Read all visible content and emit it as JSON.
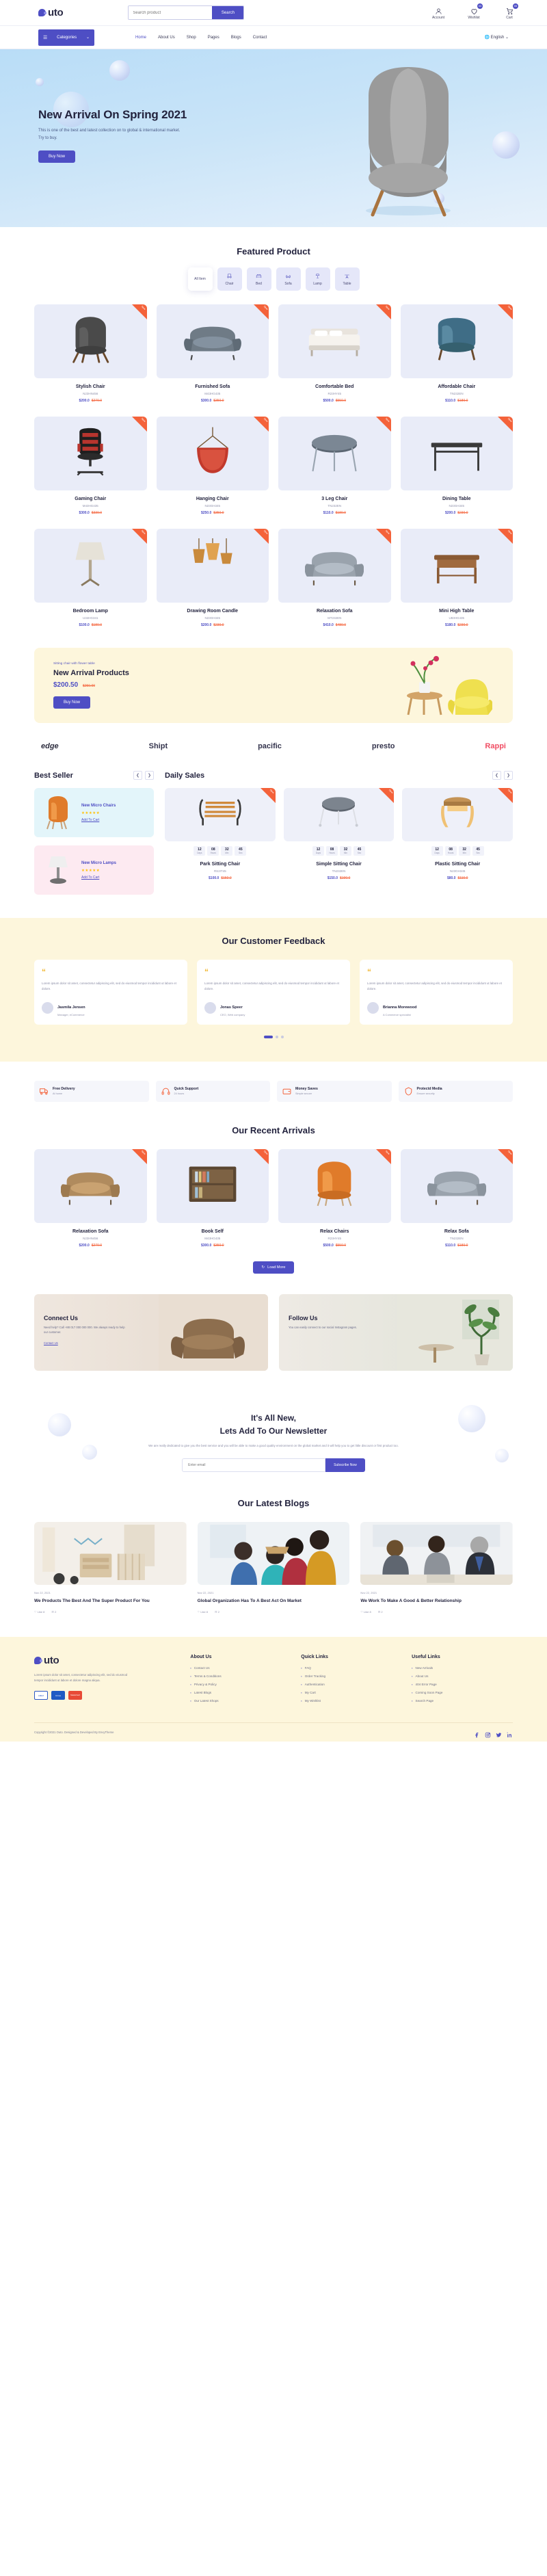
{
  "brand": {
    "name": "uto"
  },
  "header": {
    "search": {
      "placeholder": "Search product",
      "value": "",
      "button": "Search"
    },
    "icons": [
      {
        "name": "Account",
        "badge": ""
      },
      {
        "name": "Wishlist",
        "badge": "03"
      },
      {
        "name": "Cart",
        "badge": "05"
      }
    ]
  },
  "nav": {
    "categories_label": "Categories",
    "links": [
      {
        "label": "Home",
        "caret": true,
        "active": true
      },
      {
        "label": "About Us",
        "caret": false,
        "active": false
      },
      {
        "label": "Shop",
        "caret": true,
        "active": false
      },
      {
        "label": "Pages",
        "caret": true,
        "active": false
      },
      {
        "label": "Blogs",
        "caret": true,
        "active": false
      },
      {
        "label": "Contact",
        "caret": false,
        "active": false
      }
    ],
    "language": "English"
  },
  "hero": {
    "title": "New Arrival On Spring 2021",
    "text": "This is one of the best and latest collection on to global & international market. Try to buy.",
    "cta": "Buy Now"
  },
  "featured": {
    "title": "Featured Product",
    "tabs": [
      {
        "label": "All Item",
        "icon": "grid-icon",
        "active": true
      },
      {
        "label": "Chair",
        "icon": "chair-icon",
        "active": false
      },
      {
        "label": "Bed",
        "icon": "bed-icon",
        "active": false
      },
      {
        "label": "Sofa",
        "icon": "sofa-icon",
        "active": false
      },
      {
        "label": "Lamp",
        "icon": "lamp-icon",
        "active": false
      },
      {
        "label": "Table",
        "icon": "table-icon",
        "active": false
      }
    ],
    "ribbon": "New",
    "products": [
      {
        "name": "Stylish Chair",
        "sku": "N23HN456",
        "price": "$200.0",
        "old": "$270.0",
        "art": "chair-dark"
      },
      {
        "name": "Furnished Sofa",
        "sku": "M43HG435",
        "price": "$300.0",
        "old": "$350.0",
        "art": "sofa-grey"
      },
      {
        "name": "Comfortable Bed",
        "sku": "R23HY45",
        "price": "$500.0",
        "old": "$550.0",
        "art": "bed-white"
      },
      {
        "name": "Affordable Chair",
        "sku": "TN232EN",
        "price": "$110.0",
        "old": "$180.0",
        "art": "chair-blue"
      },
      {
        "name": "Gaming Chair",
        "sku": "M43HG435",
        "price": "$300.0",
        "old": "$330.0",
        "art": "chair-gaming"
      },
      {
        "name": "Hanging Chair",
        "sku": "N23GH345",
        "price": "$250.0",
        "old": "$350.0",
        "art": "chair-hanging"
      },
      {
        "name": "3 Leg Chair",
        "sku": "TN232EN",
        "price": "$110.0",
        "old": "$180.0",
        "art": "table-round"
      },
      {
        "name": "Dining Table",
        "sku": "N23GH345",
        "price": "$200.0",
        "old": "$230.0",
        "art": "table-dining"
      },
      {
        "name": "Bedroom Lamp",
        "sku": "U34HG341",
        "price": "$100.0",
        "old": "$180.0",
        "art": "lamp-floor"
      },
      {
        "name": "Drawing Room Candle",
        "sku": "N23GH345",
        "price": "$200.0",
        "old": "$230.0",
        "art": "lamp-pendant"
      },
      {
        "name": "Relaxation Sofa",
        "sku": "MT232EN",
        "price": "$410.0",
        "old": "$480.0",
        "art": "sofa-relax"
      },
      {
        "name": "Mini High Table",
        "sku": "U83HG435",
        "price": "$180.0",
        "old": "$230.0",
        "art": "table-mini"
      }
    ]
  },
  "promo": {
    "eyebrow": "Sitting chair with flower table",
    "title": "New Arrival Products",
    "price": "$200.50",
    "old": "$250.00",
    "cta": "Buy Now"
  },
  "brands": [
    "edge",
    "Shipt",
    "pacific",
    "presto",
    "Rappi"
  ],
  "best_seller": {
    "title": "Best Seller",
    "items": [
      {
        "name": "New Micro Chairs",
        "stars": "★★★★★",
        "cta": "Add To Cart",
        "theme": "blue",
        "art": "chair-orange"
      },
      {
        "name": "New Micro Lamps",
        "stars": "★★★★★",
        "cta": "Add To Cart",
        "theme": "pink",
        "art": "lamp-small"
      }
    ]
  },
  "daily_sales": {
    "title": "Daily Sales",
    "timer_labels": [
      "Days",
      "Hours",
      "Min",
      "Sec"
    ],
    "items": [
      {
        "name": "Park Sitting Chair",
        "sku": "RS2IT45",
        "price": "$100.0",
        "old": "$150.0",
        "timer": [
          "12",
          "08",
          "32",
          "45"
        ],
        "art": "bench"
      },
      {
        "name": "Simple Sitting Chair",
        "sku": "TN232EN",
        "price": "$150.0",
        "old": "$190.0",
        "timer": [
          "12",
          "08",
          "32",
          "45"
        ],
        "art": "stool-grey"
      },
      {
        "name": "Plastic Sitting Chair",
        "sku": "N23GH345",
        "price": "$80.0",
        "old": "$110.0",
        "timer": [
          "12",
          "08",
          "32",
          "45"
        ],
        "art": "stool-wood"
      }
    ]
  },
  "feedback": {
    "title": "Our Customer Feedback",
    "cards": [
      {
        "text": "Lorem ipsum dolor sit amet, consectetur adipiscing elit, sed do eiusmod tempor incididunt ut labore et dolore.",
        "name": "Jasmila Jensen",
        "role": "Manager, eCommerce"
      },
      {
        "text": "Lorem ipsum dolor sit amet, consectetur adipiscing elit, sed do eiusmod tempor incididunt ut labore et dolore.",
        "name": "Jonas Speer",
        "role": "CEO, Web company"
      },
      {
        "text": "Lorem ipsum dolor sit amet, consectetur adipiscing elit, sed do eiusmod tempor incididunt ut labore et dolore.",
        "name": "Brianna Morewood",
        "role": "A Commerce specialist"
      }
    ]
  },
  "features": [
    {
      "icon": "truck-icon",
      "title": "Free Delivery",
      "sub": "At home"
    },
    {
      "icon": "headset-icon",
      "title": "Quick Support",
      "sub": "24 hours"
    },
    {
      "icon": "wallet-icon",
      "title": "Money Saves",
      "sub": "Simple secure"
    },
    {
      "icon": "shield-icon",
      "title": "Protectd Media",
      "sub": "Ensure security"
    }
  ],
  "recent": {
    "title": "Our Recent Arrivals",
    "ribbon": "New",
    "products": [
      {
        "name": "Relaxation Sofa",
        "sku": "N23HN456",
        "price": "$200.0",
        "old": "$270.0",
        "art": "sofa-tan"
      },
      {
        "name": "Book Self",
        "sku": "M43HG435",
        "price": "$300.0",
        "old": "$350.0",
        "art": "bookshelf"
      },
      {
        "name": "Relax Chairs",
        "sku": "R23HY45",
        "price": "$500.0",
        "old": "$550.0",
        "art": "chair-orange2"
      },
      {
        "name": "Relax Sofa",
        "sku": "TN232EN",
        "price": "$110.0",
        "old": "$180.0",
        "art": "sofa-grey2"
      }
    ],
    "load_more": "Load More"
  },
  "connect": {
    "panels": [
      {
        "title": "Connect Us",
        "desc": "Need help? Call +88 017 000 000 000. We always ready to help our customer.",
        "link": "Contact Us"
      },
      {
        "title": "Follow Us",
        "desc": "You can easily connect to our social Instagram pages.",
        "link": ""
      }
    ]
  },
  "newsletter": {
    "title_line1": "It's All New,",
    "title_line2": "Lets Add To Our Newsletter",
    "text": "We are really dedicated to give you the best service and you will be able to make a good quality environment on the global market and it will help you to get little discount or first product too.",
    "placeholder": "Enter email",
    "button": "Subscribe Now"
  },
  "blogs": {
    "title": "Our Latest Blogs",
    "posts": [
      {
        "date": "Nov 22, 2021",
        "title": "We Products The Best And The Super Product For You",
        "likes": "Like 8",
        "comments": "2",
        "img": "nursery-room"
      },
      {
        "date": "Nov 22, 2021",
        "title": "Global Organization Has To A Best Act On Market",
        "likes": "Like 8",
        "comments": "2",
        "img": "people-group"
      },
      {
        "date": "Nov 22, 2021",
        "title": "We Work To Make A Good & Better Relationship",
        "likes": "Like 8",
        "comments": "2",
        "img": "business-meeting"
      }
    ]
  },
  "footer": {
    "about_text": "Lorem ipsum dolor sit amet, consectetur adipiscing elit, sed do eiusmod tempor incididunt ut labore et dolore magna aliqua.",
    "cards": [
      "AMEX",
      "Cirrus",
      "MasterCard"
    ],
    "columns": [
      {
        "title": "About Us",
        "links": [
          "Contact Us",
          "Terms & Conditions",
          "Privacy & Policy",
          "Latest Blogs",
          "Our Latest Shops"
        ]
      },
      {
        "title": "Quick Links",
        "links": [
          "FAQ",
          "Order Tracking",
          "Authentication",
          "My Cart",
          "My Wishlist"
        ]
      },
      {
        "title": "Useful Links",
        "links": [
          "New Arrivals",
          "About Us",
          "404 Error Page",
          "Coming Soon Page",
          "Search Page"
        ]
      }
    ],
    "copyright": "Copyright ©2021 Outo. Designed & Developed By EnvyTheme",
    "socials": [
      "facebook-icon",
      "instagram-icon",
      "twitter-icon",
      "linkedin-icon"
    ]
  },
  "colors": {
    "accent": "#4e4ec4",
    "orange": "#f4623a",
    "cream": "#fdf6dc"
  }
}
